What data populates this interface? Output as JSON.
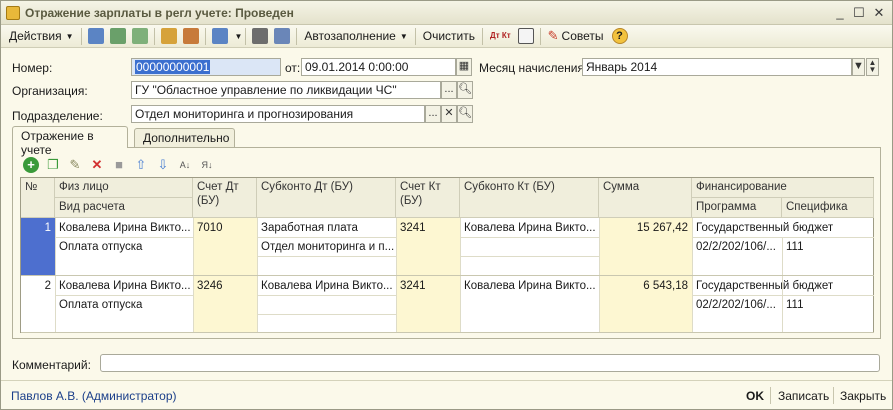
{
  "window": {
    "title": "Отражение зарплаты в регл учете: Проведен",
    "controls": {
      "minimize": "_",
      "maximize": "☐",
      "close": "✕"
    }
  },
  "toolbar": {
    "actions": "Действия",
    "autofill": "Автозаполнение",
    "clear": "Очистить",
    "dtkt": "Дт Кт",
    "tips": "Советы",
    "help": "?"
  },
  "form": {
    "number_label": "Номер:",
    "number_value": "00000000001",
    "from_label": "от:",
    "date_value": "09.01.2014  0:00:00",
    "month_label": "Месяц начисления:",
    "month_value": "Январь 2014",
    "org_label": "Организация:",
    "org_value": "ГУ \"Областное управление по ликвидации ЧС\"",
    "dept_label": "Подразделение:",
    "dept_value": "Отдел мониторинга и прогнозирования",
    "ellipsis": "...",
    "clear_x": "✕"
  },
  "tabs": [
    {
      "label": "Отражение в учете"
    },
    {
      "label": "Дополнительно"
    }
  ],
  "grid": {
    "headers": {
      "num": "№",
      "person": "Физ лицо",
      "calc_type": "Вид расчета",
      "acc_dt": "Счет Дт (БУ)",
      "sub_dt": "Субконто Дт (БУ)",
      "acc_kt": "Счет Кт (БУ)",
      "sub_kt": "Субконто Кт (БУ)",
      "sum": "Сумма",
      "financing": "Финансирование",
      "program": "Программа",
      "spec": "Специфика"
    },
    "rows": [
      {
        "num": "1",
        "person": "Ковалева Ирина Викто...",
        "calc_type": "Оплата отпуска",
        "acc_dt": "7010",
        "sub_dt_1": "Заработная плата",
        "sub_dt_2": "Отдел мониторинга и п...",
        "acc_kt": "3241",
        "sub_kt": "Ковалева Ирина Викто...",
        "sum": "15 267,42",
        "financing": "Государственный бюджет",
        "program": "02/2/202/106/...",
        "spec": "111"
      },
      {
        "num": "2",
        "person": "Ковалева Ирина Викто...",
        "calc_type": "Оплата отпуска",
        "acc_dt": "3246",
        "sub_dt_1": "Ковалева Ирина Викто...",
        "sub_dt_2": "",
        "acc_kt": "3241",
        "sub_kt": "Ковалева Ирина Викто...",
        "sum": "6 543,18",
        "financing": "Государственный бюджет",
        "program": "02/2/202/106/...",
        "spec": "111"
      }
    ]
  },
  "comment_label": "Комментарий:",
  "footer": {
    "user": "Павлов А.В. (Администратор)",
    "ok": "OK",
    "save": "Записать",
    "close": "Закрыть"
  },
  "colors": {
    "window_bg": "#fbf9ea",
    "selection": "#3b6fcf",
    "highlight_column": "#fdf7d2",
    "user_link": "#1b3f8a"
  }
}
